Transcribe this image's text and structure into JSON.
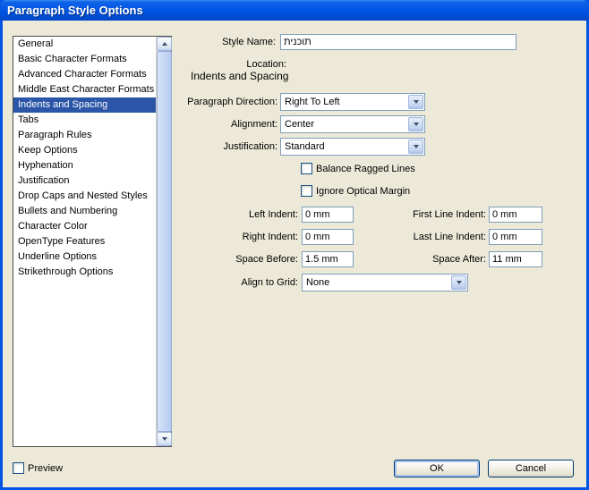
{
  "window": {
    "title": "Paragraph Style Options"
  },
  "sidebar": {
    "items": [
      {
        "label": "General",
        "selected": false
      },
      {
        "label": "Basic Character Formats",
        "selected": false
      },
      {
        "label": "Advanced Character Formats",
        "selected": false
      },
      {
        "label": "Middle East Character Formats",
        "selected": false
      },
      {
        "label": "Indents and Spacing",
        "selected": true
      },
      {
        "label": "Tabs",
        "selected": false
      },
      {
        "label": "Paragraph Rules",
        "selected": false
      },
      {
        "label": "Keep Options",
        "selected": false
      },
      {
        "label": "Hyphenation",
        "selected": false
      },
      {
        "label": "Justification",
        "selected": false
      },
      {
        "label": "Drop Caps and Nested Styles",
        "selected": false
      },
      {
        "label": "Bullets and Numbering",
        "selected": false
      },
      {
        "label": "Character Color",
        "selected": false
      },
      {
        "label": "OpenType Features",
        "selected": false
      },
      {
        "label": "Underline Options",
        "selected": false
      },
      {
        "label": "Strikethrough Options",
        "selected": false
      }
    ]
  },
  "header": {
    "style_name_label": "Style Name:",
    "style_name_value": "תוכנית",
    "location_label": "Location:",
    "section_title": "Indents and Spacing"
  },
  "form": {
    "paragraph_direction": {
      "label": "Paragraph Direction:",
      "value": "Right To Left"
    },
    "alignment": {
      "label": "Alignment:",
      "value": "Center"
    },
    "justification": {
      "label": "Justification:",
      "value": "Standard"
    },
    "balance_ragged_lines": {
      "label": "Balance Ragged Lines",
      "checked": false
    },
    "ignore_optical_margin": {
      "label": "Ignore Optical Margin",
      "checked": false
    },
    "left_indent": {
      "label": "Left Indent:",
      "value": "0 mm"
    },
    "first_line_indent": {
      "label": "First Line Indent:",
      "value": "0 mm"
    },
    "right_indent": {
      "label": "Right Indent:",
      "value": "0 mm"
    },
    "last_line_indent": {
      "label": "Last Line Indent:",
      "value": "0 mm"
    },
    "space_before": {
      "label": "Space Before:",
      "value": "1.5 mm"
    },
    "space_after": {
      "label": "Space After:",
      "value": "11 mm"
    },
    "align_to_grid": {
      "label": "Align to Grid:",
      "value": "None"
    }
  },
  "footer": {
    "preview": {
      "label": "Preview",
      "checked": false
    },
    "ok_label": "OK",
    "cancel_label": "Cancel"
  },
  "colors": {
    "titlebar": "#0054E3",
    "dialog_bg": "#ECE9D8",
    "selection": "#2B56A8",
    "field_border": "#7F9DB9"
  }
}
